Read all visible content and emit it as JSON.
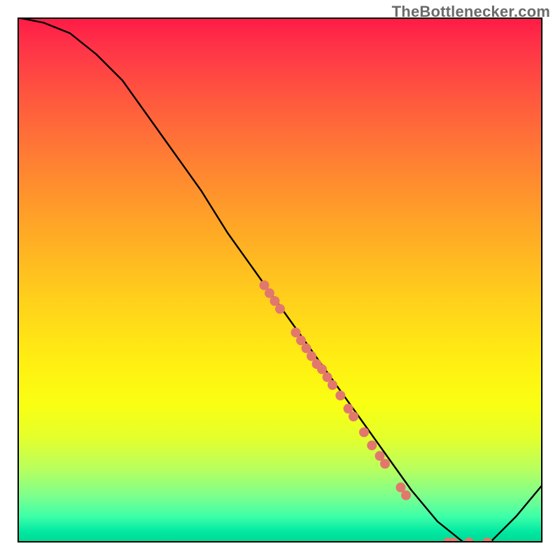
{
  "watermark": "TheBottlenecker.com",
  "chart_data": {
    "type": "line",
    "title": "",
    "xlabel": "",
    "ylabel": "",
    "xlim": [
      0,
      100
    ],
    "ylim": [
      0,
      100
    ],
    "grid": false,
    "legend": false,
    "series": [
      {
        "name": "bottleneck-curve",
        "x": [
          0,
          5,
          10,
          15,
          20,
          25,
          30,
          35,
          40,
          45,
          50,
          55,
          60,
          65,
          70,
          75,
          80,
          85,
          88,
          90,
          95,
          100
        ],
        "y": [
          100,
          99,
          97,
          93,
          88,
          81,
          74,
          67,
          59,
          52,
          45,
          38,
          31,
          24,
          17,
          10,
          4,
          0,
          0,
          0,
          5,
          11
        ]
      }
    ],
    "points": {
      "name": "data-points",
      "color": "#e2786d",
      "radius": 7,
      "xy": [
        [
          47,
          49
        ],
        [
          48,
          47.5
        ],
        [
          49,
          46
        ],
        [
          50,
          44.5
        ],
        [
          53,
          40
        ],
        [
          54,
          38.5
        ],
        [
          55,
          37
        ],
        [
          56,
          35.5
        ],
        [
          57,
          34
        ],
        [
          58,
          33
        ],
        [
          59,
          31.5
        ],
        [
          60,
          30
        ],
        [
          61.5,
          28
        ],
        [
          63,
          25.5
        ],
        [
          64,
          24
        ],
        [
          66,
          21
        ],
        [
          67.5,
          18.5
        ],
        [
          69,
          16.5
        ],
        [
          70,
          15
        ],
        [
          73,
          10.5
        ],
        [
          74,
          9
        ],
        [
          82,
          0
        ],
        [
          83,
          0
        ],
        [
          86,
          0
        ],
        [
          89.5,
          0
        ]
      ]
    },
    "background_gradient": {
      "top": "#ff1a46",
      "upper_mid": "#ffce1c",
      "lower_mid": "#e4ff2c",
      "bottom": "#00d992"
    }
  }
}
